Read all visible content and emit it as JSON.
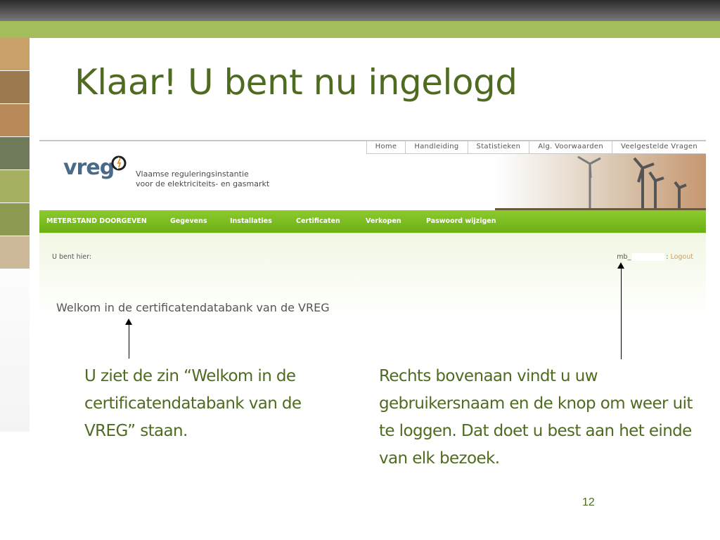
{
  "slide": {
    "title": "Klaar! U bent nu ingelogd",
    "page_number": "12",
    "callout_left": "U ziet de zin “Welkom in de certificatendatabank van de VREG” staan.",
    "callout_right": "Rechts bovenaan vindt u uw gebruikersnaam en de knop om weer uit te loggen. Dat doet u best aan het einde van elk bezoek."
  },
  "colors": {
    "title": "#4f6b20",
    "top_bar": "#a3bd5c",
    "nav_green": "#7bbd1e",
    "logout": "#e89a2a"
  },
  "website": {
    "top_nav": [
      "Home",
      "Handleiding",
      "Statistieken",
      "Alg. Voorwaarden",
      "Veelgestelde Vragen"
    ],
    "logo": "vreg",
    "tagline_line1": "Vlaamse reguleringsinstantie",
    "tagline_line2": "voor de elektriciteits- en gasmarkt",
    "main_menu": [
      "METERSTAND DOORGEVEN",
      "Gegevens",
      "Installaties",
      "Certificaten",
      "Verkopen",
      "Paswoord wijzigen"
    ],
    "breadcrumb": "U bent hier:",
    "username_prefix": "mb_",
    "username_separator": ":",
    "logout": "Logout",
    "welcome": "Welkom in de certificatendatabank van de VREG"
  },
  "icons": [
    "logo-mark-icon",
    "arrow-up-icon"
  ]
}
